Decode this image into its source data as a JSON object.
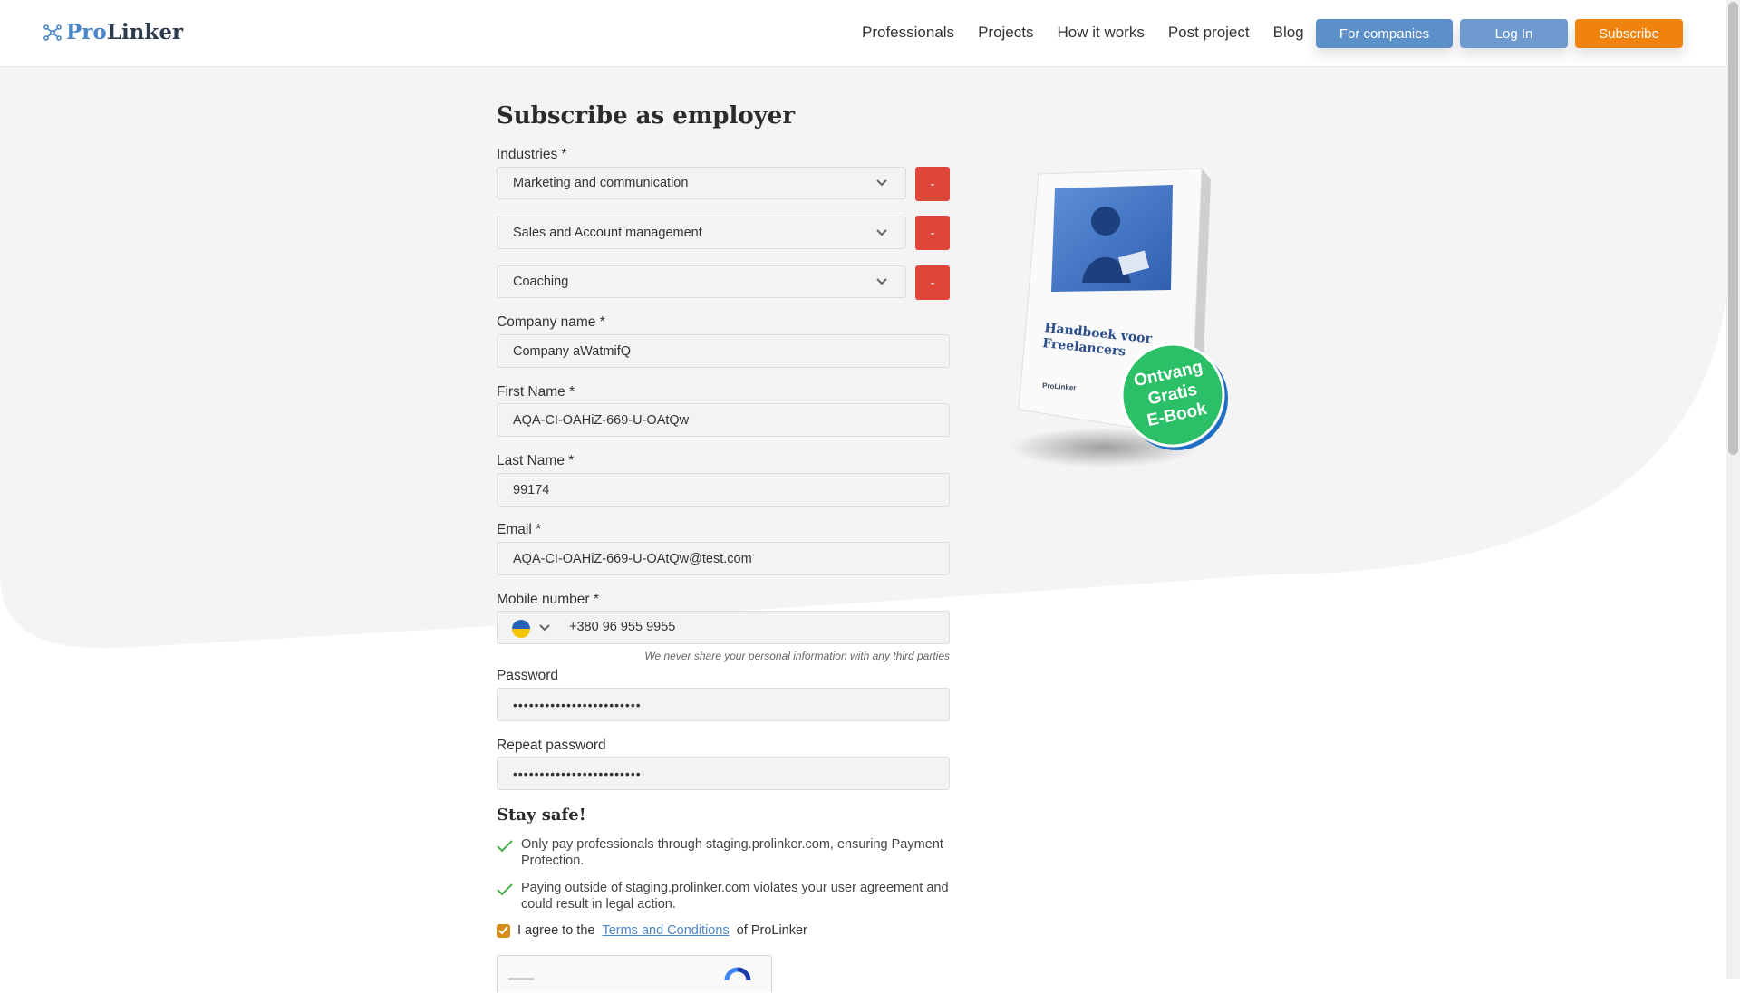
{
  "header": {
    "logo_pro": "Pro",
    "logo_linker": "Linker",
    "nav": [
      "Professionals",
      "Projects",
      "How it works",
      "Post project",
      "Blog"
    ],
    "for_companies": "For companies",
    "login": "Log In",
    "subscribe": "Subscribe"
  },
  "form": {
    "title": "Subscribe as employer",
    "industries_label": "Industries *",
    "industries": [
      "Marketing and communication",
      "Sales and Account management",
      "Coaching"
    ],
    "remove_label": "-",
    "company_label": "Company name *",
    "company_value": "Company aWatmifQ",
    "first_name_label": "First Name *",
    "first_name_value": "AQA-CI-OAHiZ-669-U-OAtQw",
    "last_name_label": "Last Name *",
    "last_name_value": "99174",
    "email_label": "Email *",
    "email_value": "AQA-CI-OAHiZ-669-U-OAtQw@test.com",
    "mobile_label": "Mobile number *",
    "mobile_value": "+380 96 955 9955",
    "privacy_note": "We never share your personal information with any third parties",
    "password_label": "Password",
    "password_value": "••••••••••••••••••••••••",
    "repeat_password_label": "Repeat password",
    "repeat_password_value": "••••••••••••••••••••••••",
    "stay_safe_title": "Stay safe!",
    "safe_items": [
      "Only pay professionals through staging.prolinker.com, ensuring Payment Protection.",
      "Paying outside of staging.prolinker.com violates your user agreement and could result in legal action."
    ],
    "agree_prefix": "I agree to the",
    "agree_link": "Terms and Conditions",
    "agree_suffix": "of ProLinker"
  },
  "ebook": {
    "title_line1": "Handboek voor",
    "title_line2": "Freelancers",
    "brand": "ProLinker",
    "badge_line1": "Ontvang",
    "badge_line2": "Gratis",
    "badge_line3": "E-Book"
  },
  "colors": {
    "accent_blue": "#5d8fc9",
    "subscribe_orange": "#f0830e",
    "remove_red": "#e0453a",
    "badge_green": "#2bbf67",
    "check_green": "#4caf50"
  },
  "icons": [
    "logo-icon",
    "chevron-down-icon",
    "ukraine-flag-icon",
    "check-icon"
  ]
}
